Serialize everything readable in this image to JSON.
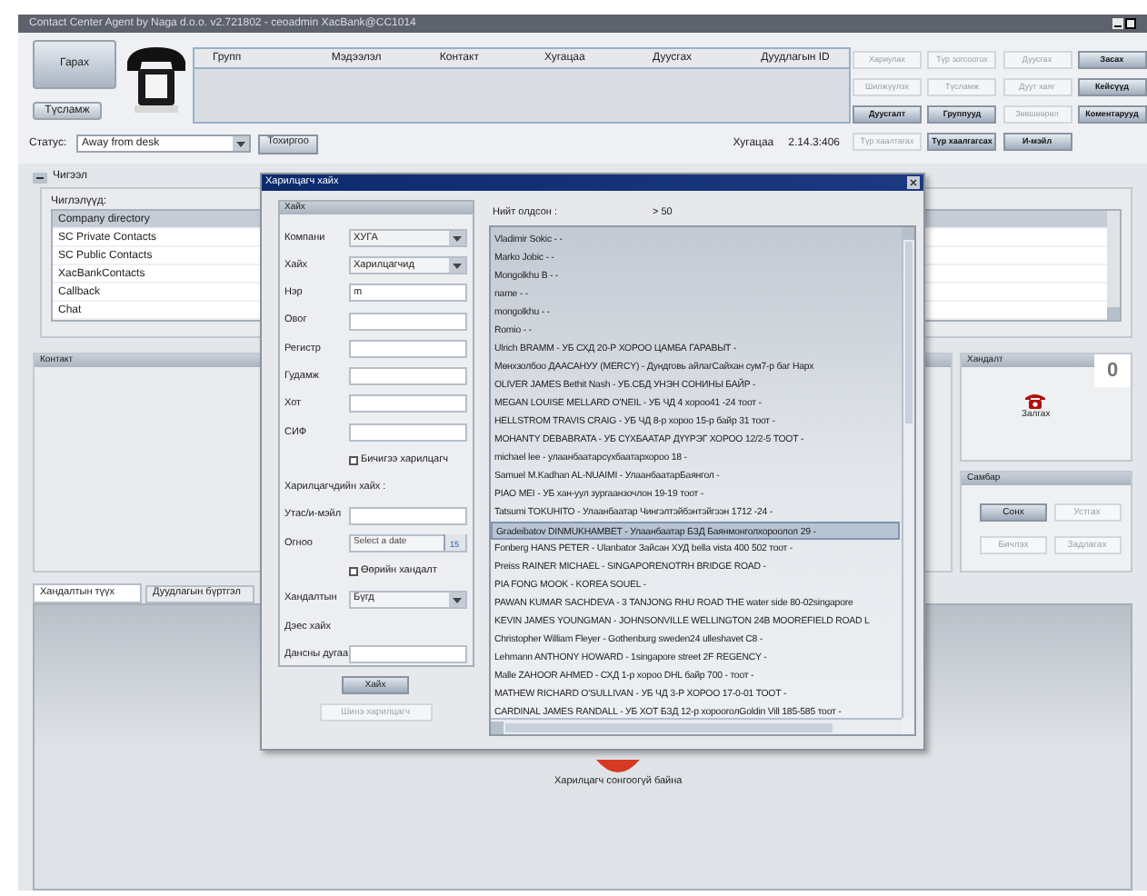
{
  "window": {
    "title": "Contact Center Agent by Naga d.o.o. v2.721802 - ceoadmin XacBank@CC1014"
  },
  "toolbar": {
    "exit_button": "Гарах",
    "help_button": "Түсламж"
  },
  "calls_table": {
    "columns": [
      "Групп",
      "Мэдээлэл",
      "Контакт",
      "Хугацаа",
      "Дуусгах",
      "Дуудлагын ID"
    ]
  },
  "action_buttons": [
    {
      "label": "Хариулах",
      "disabled": true
    },
    {
      "label": "Түр зогсоогох",
      "disabled": true
    },
    {
      "label": "Дуусгах",
      "disabled": true
    },
    {
      "label": "Засах",
      "disabled": false
    },
    {
      "label": "Шилжүүлэх",
      "disabled": true
    },
    {
      "label": "Түсламж",
      "disabled": true
    },
    {
      "label": "Дуут хаяг",
      "disabled": true
    },
    {
      "label": "Кейсүүд",
      "disabled": false
    },
    {
      "label": "Дуусгалт",
      "disabled": false
    },
    {
      "label": "Группууд",
      "disabled": false
    },
    {
      "label": "Зөвшөөрөл",
      "disabled": true
    },
    {
      "label": "Коментарууд",
      "disabled": false
    },
    {
      "label": "Түр хаалтагах",
      "disabled": true
    },
    {
      "label": "Түр хаалгагсах",
      "disabled": false
    },
    {
      "label": "И-мэйл",
      "disabled": false
    }
  ],
  "status": {
    "label": "Статус:",
    "value": "Away from desk",
    "settings_button": "Тохиргоо",
    "time_label": "Хугацаа",
    "time_value": "2.14.3:406"
  },
  "routes": {
    "title": "Чигээл",
    "expanded": true,
    "list_label": "Чиглэлүүд:",
    "items": [
      {
        "label": "Company directory",
        "selected": true
      },
      {
        "label": "SC Private Contacts",
        "selected": false
      },
      {
        "label": "SC Public Contacts",
        "selected": false
      },
      {
        "label": "XacBankContacts",
        "selected": false
      },
      {
        "label": "Callback",
        "selected": false
      },
      {
        "label": "Chat",
        "selected": false
      }
    ]
  },
  "contact_panel": {
    "title": "Контакт"
  },
  "access_panel": {
    "title": "Хандалт",
    "call_button": "Залгах",
    "counter": "0"
  },
  "board_panel": {
    "title": "Самбар",
    "buttons": [
      {
        "label": "Сонх",
        "disabled": false
      },
      {
        "label": "Устгах",
        "disabled": true
      },
      {
        "label": "Бичлэх",
        "disabled": true
      },
      {
        "label": "Задлагах",
        "disabled": true
      }
    ]
  },
  "tabs": [
    {
      "label": "Хандалтын түүх",
      "selected": true
    },
    {
      "label": "Дуудлагын бүртгэл",
      "selected": false
    }
  ],
  "empty_state": {
    "message": "Харилцагч сонгоогүй байна"
  },
  "dialog": {
    "title": "Харилцагч хайх",
    "search_group": {
      "title": "Хайх",
      "fields": [
        {
          "kind": "select",
          "label": "Компани",
          "value": "ХУГА"
        },
        {
          "kind": "select",
          "label": "Хайх",
          "value": "Харилцагчид"
        },
        {
          "kind": "text",
          "label": "Нэр",
          "value": "m"
        },
        {
          "kind": "text",
          "label": "Овог"
        },
        {
          "kind": "text",
          "label": "Регистр"
        },
        {
          "kind": "text",
          "label": "Гудамж"
        },
        {
          "kind": "text",
          "label": "Хот"
        },
        {
          "kind": "text",
          "label": "СИФ"
        },
        {
          "kind": "checkbox",
          "label": "Бичигээ харилцагч",
          "checked": false
        },
        {
          "kind": "heading",
          "label": "Харилцагчдийн хайх :"
        },
        {
          "kind": "text",
          "label": "Утас/и-мэйл"
        },
        {
          "kind": "date",
          "label": "Огноо",
          "placeholder": "Select a date",
          "button": "15"
        },
        {
          "kind": "checkbox",
          "label": "Өөрийн хандалт",
          "checked": false
        },
        {
          "kind": "select",
          "label": "Хандалтын",
          "value": "Бүгд"
        },
        {
          "kind": "heading",
          "label": "Дэес хайх"
        },
        {
          "kind": "text",
          "label": "Дансны дугаа"
        }
      ]
    },
    "search_button": "Хайх",
    "new_button": {
      "label": "Шинэ харилцагч",
      "disabled": true
    },
    "results_label": "Нийт олдсон :",
    "results_count": "> 50",
    "results": [
      {
        "text": "Vladimir Sokic - -",
        "selected": false
      },
      {
        "text": "Marko Jobic - -",
        "selected": false
      },
      {
        "text": "Mongolkhu B - -",
        "selected": false
      },
      {
        "text": "name - -",
        "selected": false
      },
      {
        "text": "mongolkhu - -",
        "selected": false
      },
      {
        "text": "Romio - -",
        "selected": false
      },
      {
        "text": "Ulrich BRAMM - УБ СХД 20-Р ХОРОО ЦАМБА ГАРАВЫТ -",
        "selected": false
      },
      {
        "text": "Мөнхзолбоо ДААСАНУУ (MERCY) - Дундговь айлагСайхан сум7-р баг Нарх",
        "selected": false
      },
      {
        "text": "OLIVER JAMES Bethit Nash - УБ.СБД УНЭН СОНИНЫ БАЙР -",
        "selected": false
      },
      {
        "text": "MEGAN LOUISE MELLARD O'NEIL - УБ ЧД 4 хороо41 -24 тоот -",
        "selected": false
      },
      {
        "text": "HELLSTROM TRAVIS CRAIG - УБ ЧД 8-р хороо 15-р байр 31 тоот -",
        "selected": false
      },
      {
        "text": "MOHANTY DEBABRATA - УБ СҮХБААТАР ДҮҮРЭГ ХОРОО 12/2-5 ТООТ -",
        "selected": false
      },
      {
        "text": "michael lee - улаанбаатарсүхбаатархороо 18 -",
        "selected": false
      },
      {
        "text": "Samuel M.Kadhan AL-NUAIMI - УлаанбаатарБаянгол -",
        "selected": false
      },
      {
        "text": "PIAO MEI - УБ хан-уул зургаанзочлон 19-19 тоот -",
        "selected": false
      },
      {
        "text": "Tatsumi TOKUHITO - Улаанбаатар Чингэлтэйбэнтэйгээн 1712 -24 -",
        "selected": false
      },
      {
        "text": "Gradeibatov DINMUKHAMBET - Улаанбаатар БЗД Баянмонголхороолол 29 -",
        "selected": true
      },
      {
        "text": "Fonberg HANS PETER - Ulanbator Зайсан ХУД bella vista 400 502 тоот -",
        "selected": false
      },
      {
        "text": "Preiss RAINER MICHAEL - SINGAPORENOTRH BRIDGE ROAD -",
        "selected": false
      },
      {
        "text": "PIA FONG MOOK - KOREA SOUEL -",
        "selected": false
      },
      {
        "text": "PAWAN KUMAR SACHDEVA - 3 TANJONG RHU ROAD THE water side 80-02singapore",
        "selected": false
      },
      {
        "text": "KEVIN JAMES YOUNGMAN - JOHNSONVILLE WELLINGTON 24B MOOREFIELD ROAD L",
        "selected": false
      },
      {
        "text": "Christopher William Fleyer - Gothenburg sweden24 ulleshavet C8 -",
        "selected": false
      },
      {
        "text": "Lehmann ANTHONY HOWARD - 1singapore street 2F REGENCY -",
        "selected": false
      },
      {
        "text": "Malle ZAHOOR AHMED - СХД 1-р хороо DHL байр 700 - тоот -",
        "selected": false
      },
      {
        "text": "MATHEW RICHARD O'SULLIVAN - УБ ЧД 3-Р ХОРОО 17-0-01 ТООТ -",
        "selected": false
      },
      {
        "text": "CARDINAL JAMES RANDALL - УБ ХОТ БЗД 12-р хорооголGoldin Vill 185-585 тоот -",
        "selected": false
      }
    ]
  }
}
